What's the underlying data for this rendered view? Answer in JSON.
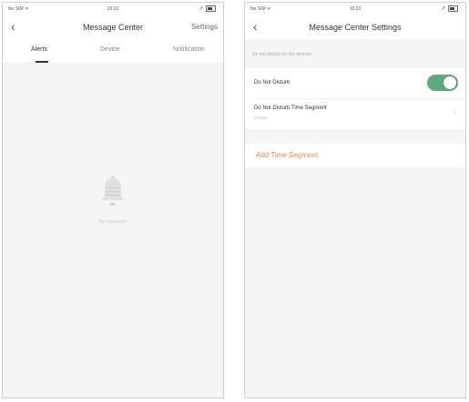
{
  "left_screen": {
    "status_bar": {
      "carrier": "No SIM ᯤ",
      "time": "10:32"
    },
    "nav": {
      "title": "Message Center",
      "settings_label": "Settings"
    },
    "tabs": [
      {
        "label": "Alerts",
        "active": true
      },
      {
        "label": "Device",
        "active": false
      },
      {
        "label": "Notification",
        "active": false
      }
    ],
    "empty_state": {
      "icon": "bell-icon",
      "text": "No messages"
    }
  },
  "right_screen": {
    "status_bar": {
      "carrier": "No SIM ᯤ",
      "time": "10:33"
    },
    "nav": {
      "title": "Message Center Settings"
    },
    "section_header": "Do not disturb for the devices",
    "dnd": {
      "label": "Do Not Disturb",
      "enabled": true,
      "time_segment_label": "Do Not Disturb Time Segment",
      "time_segment_value": "All-Day"
    },
    "add_time_segment_label": "Add Time Segment"
  },
  "colors": {
    "toggle_on": "#5fa97e",
    "accent_orange": "#e38a5c",
    "background_gray": "#f5f5f5"
  }
}
